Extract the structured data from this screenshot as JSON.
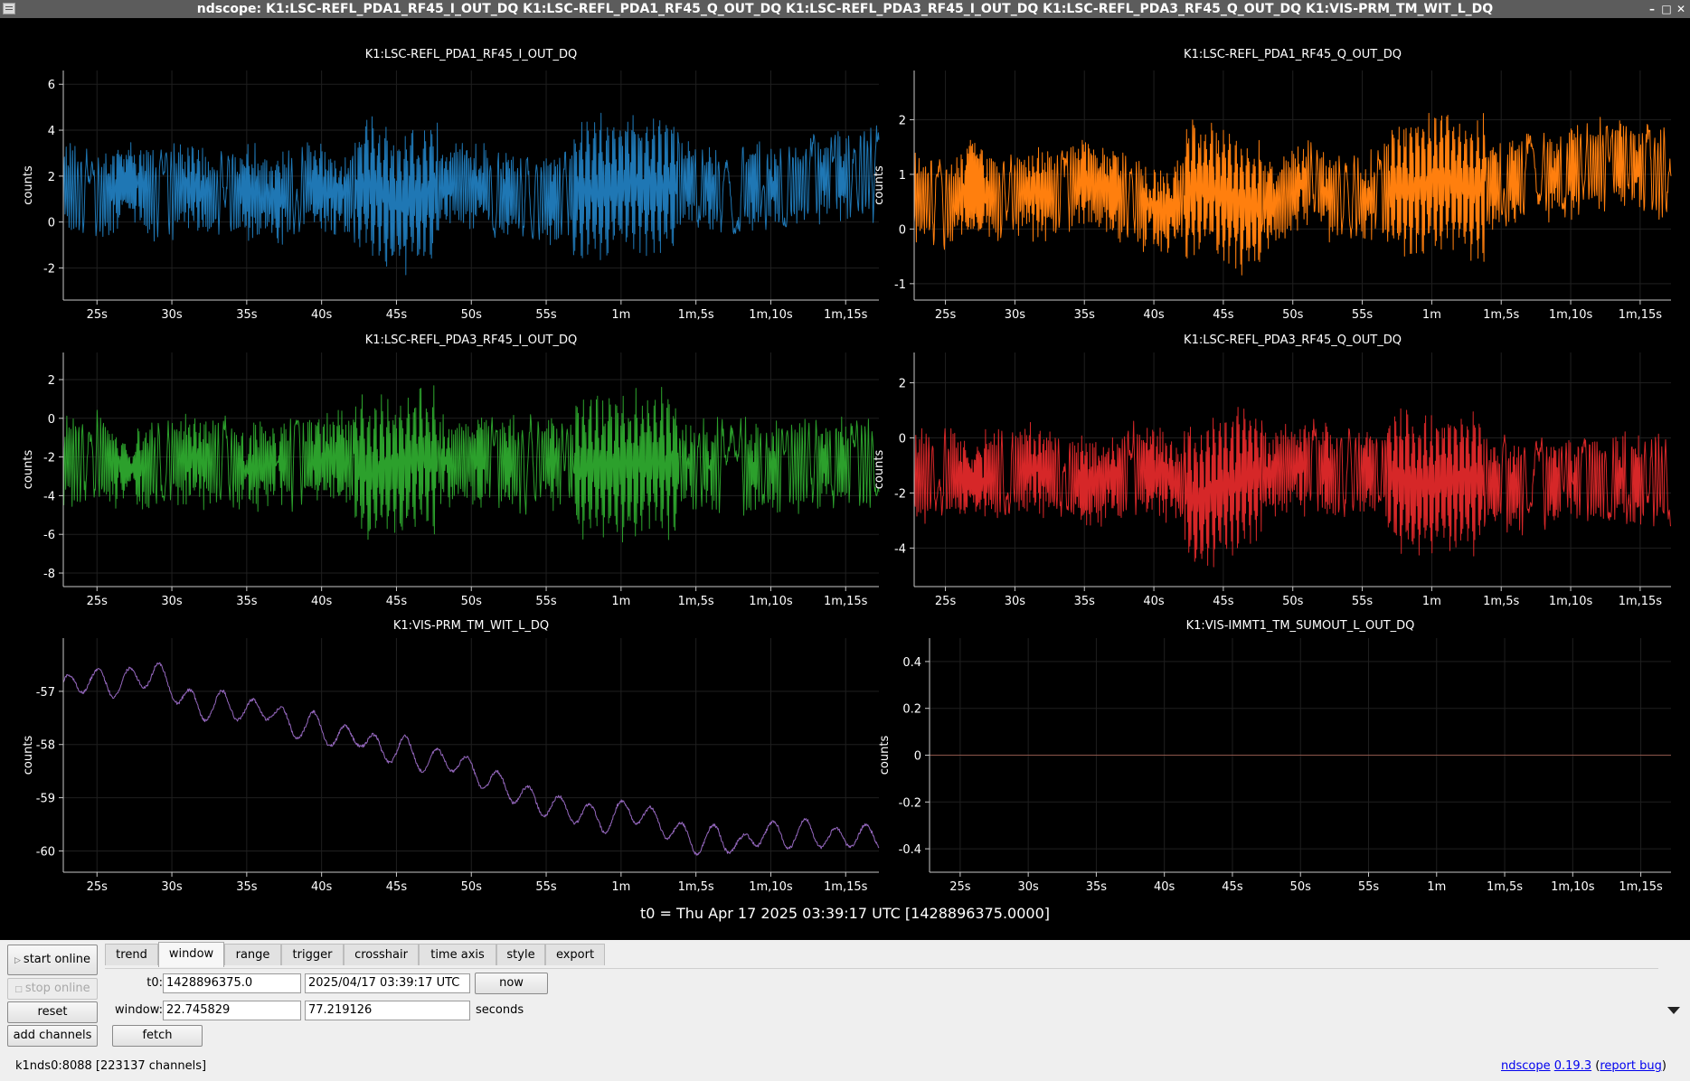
{
  "window": {
    "title": "ndscope: K1:LSC-REFL_PDA1_RF45_I_OUT_DQ K1:LSC-REFL_PDA1_RF45_Q_OUT_DQ K1:LSC-REFL_PDA3_RF45_I_OUT_DQ K1:LSC-REFL_PDA3_RF45_Q_OUT_DQ K1:VIS-PRM_TM_WIT_L_DQ",
    "minimize_glyph": "–",
    "maximize_glyph": "□",
    "close_glyph": "✕"
  },
  "x_ticks": [
    "25s",
    "30s",
    "35s",
    "40s",
    "45s",
    "50s",
    "55s",
    "1m",
    "1m,5s",
    "1m,10s",
    "1m,15s"
  ],
  "x_tick_values": [
    25,
    30,
    35,
    40,
    45,
    50,
    55,
    60,
    65,
    70,
    75
  ],
  "t0_label": "t0 = Thu Apr 17 2025 03:39:17 UTC [1428896375.0000]",
  "chart_data": [
    {
      "type": "line",
      "title": "K1:LSC-REFL_PDA1_RF45_I_OUT_DQ",
      "ylabel": "counts",
      "color": "#1f77b4",
      "xlim": [
        22.75,
        77.22
      ],
      "ylim": [
        -3.4,
        6.6
      ],
      "yticks": [
        -2,
        0,
        2,
        4,
        6
      ],
      "series": [
        {
          "x": [
            22.75,
            25,
            27,
            29,
            31,
            33,
            35,
            37,
            39,
            41,
            43,
            45,
            47,
            49,
            51,
            53,
            55,
            57,
            59,
            61,
            63,
            65,
            67,
            69,
            71,
            73,
            75,
            77.22
          ],
          "y": [
            1.5,
            1.0,
            1.8,
            1.2,
            1.6,
            1.1,
            1.4,
            1.0,
            1.6,
            1.2,
            1.6,
            0.8,
            1.3,
            1.7,
            1.5,
            1.1,
            0.9,
            1.3,
            1.4,
            1.8,
            1.5,
            1.8,
            1.2,
            1.6,
            1.5,
            1.9,
            2.0,
            2.2
          ]
        }
      ]
    },
    {
      "type": "line",
      "title": "K1:LSC-REFL_PDA1_RF45_Q_OUT_DQ",
      "ylabel": "counts",
      "color": "#ff7f0e",
      "xlim": [
        22.75,
        77.22
      ],
      "ylim": [
        -1.3,
        2.9
      ],
      "yticks": [
        -1,
        0,
        1,
        2
      ],
      "series": [
        {
          "x": [
            22.75,
            25,
            27,
            29,
            31,
            33,
            35,
            37,
            39,
            41,
            43,
            45,
            47,
            49,
            51,
            53,
            55,
            57,
            59,
            61,
            63,
            65,
            67,
            69,
            71,
            73,
            75,
            77.22
          ],
          "y": [
            0.6,
            0.4,
            0.8,
            0.5,
            0.7,
            0.6,
            0.9,
            0.7,
            0.5,
            0.3,
            0.8,
            0.6,
            0.4,
            0.5,
            0.9,
            0.6,
            0.5,
            0.7,
            0.8,
            0.9,
            0.7,
            0.8,
            0.9,
            1.0,
            1.1,
            1.2,
            1.1,
            1.0
          ]
        }
      ]
    },
    {
      "type": "line",
      "title": "K1:LSC-REFL_PDA3_RF45_I_OUT_DQ",
      "ylabel": "counts",
      "color": "#2ca02c",
      "xlim": [
        22.75,
        77.22
      ],
      "ylim": [
        -8.7,
        3.4
      ],
      "yticks": [
        -8,
        -6,
        -4,
        -2,
        0,
        2
      ],
      "series": [
        {
          "x": [
            22.75,
            25,
            27,
            29,
            31,
            33,
            35,
            37,
            39,
            41,
            43,
            45,
            47,
            49,
            51,
            53,
            55,
            57,
            59,
            61,
            63,
            65,
            67,
            69,
            71,
            73,
            75,
            77.22
          ],
          "y": [
            -2.2,
            -2.0,
            -2.6,
            -2.4,
            -2.0,
            -2.3,
            -2.6,
            -2.2,
            -2.4,
            -2.0,
            -2.8,
            -2.5,
            -2.1,
            -2.3,
            -2.0,
            -2.4,
            -2.2,
            -2.6,
            -2.5,
            -2.4,
            -2.3,
            -2.4,
            -2.5,
            -2.6,
            -2.4,
            -2.3,
            -2.2,
            -2.4
          ]
        }
      ]
    },
    {
      "type": "line",
      "title": "K1:LSC-REFL_PDA3_RF45_Q_OUT_DQ",
      "ylabel": "counts",
      "color": "#d62728",
      "xlim": [
        22.75,
        77.22
      ],
      "ylim": [
        -5.4,
        3.1
      ],
      "yticks": [
        -4,
        -2,
        0,
        2
      ],
      "series": [
        {
          "x": [
            22.75,
            25,
            27,
            29,
            31,
            33,
            35,
            37,
            39,
            41,
            43,
            45,
            47,
            49,
            51,
            53,
            55,
            57,
            59,
            61,
            63,
            65,
            67,
            69,
            71,
            73,
            75,
            77.22
          ],
          "y": [
            -1.5,
            -1.2,
            -1.6,
            -1.3,
            -1.1,
            -1.4,
            -1.7,
            -1.4,
            -1.2,
            -1.3,
            -2.2,
            -1.8,
            -1.4,
            -1.2,
            -1.0,
            -1.3,
            -1.1,
            -1.4,
            -1.8,
            -1.6,
            -1.5,
            -1.7,
            -1.8,
            -1.6,
            -1.5,
            -1.4,
            -1.6,
            -1.5
          ]
        }
      ]
    },
    {
      "type": "line",
      "title": "K1:VIS-PRM_TM_WIT_L_DQ",
      "ylabel": "counts",
      "color": "#9467bd",
      "xlim": [
        22.75,
        77.22
      ],
      "ylim": [
        -60.4,
        -56.0
      ],
      "yticks": [
        -60,
        -59,
        -58,
        -57
      ],
      "series": [
        {
          "x": [
            22.75,
            24.5,
            26,
            27.5,
            29,
            30.5,
            32,
            33.5,
            35,
            36.5,
            38,
            39.5,
            41,
            42.5,
            44,
            45.5,
            47,
            48.5,
            50,
            51.5,
            53,
            54.5,
            56,
            57.5,
            59,
            60.5,
            62,
            63.5,
            65,
            66.5,
            68,
            69.5,
            71,
            72.5,
            74,
            75.5,
            77.22
          ],
          "y": [
            -56.95,
            -56.75,
            -56.9,
            -56.75,
            -56.65,
            -57.05,
            -57.35,
            -57.2,
            -57.4,
            -57.3,
            -57.7,
            -57.6,
            -57.9,
            -57.8,
            -58.15,
            -58.05,
            -58.35,
            -58.25,
            -58.5,
            -58.7,
            -58.9,
            -59.1,
            -59.2,
            -59.3,
            -59.45,
            -59.2,
            -59.4,
            -59.6,
            -59.85,
            -59.7,
            -59.95,
            -59.6,
            -59.75,
            -59.6,
            -59.8,
            -59.7,
            -59.75
          ]
        }
      ]
    },
    {
      "type": "line",
      "title": "K1:VIS-IMMT1_TM_SUMOUT_L_OUT_DQ",
      "ylabel": "counts",
      "color": "#8c564b",
      "xlim": [
        22.75,
        77.22
      ],
      "ylim": [
        -0.5,
        0.5
      ],
      "yticks": [
        -0.4,
        -0.2,
        0,
        0.2,
        0.4
      ],
      "series": [
        {
          "x": [
            22.75,
            77.22
          ],
          "y": [
            0,
            0
          ]
        }
      ]
    }
  ],
  "controls": {
    "start_online": "start online",
    "stop_online": "stop online",
    "reset": "reset",
    "add_channels": "add channels",
    "tabs": [
      "trend",
      "window",
      "range",
      "trigger",
      "crosshair",
      "time axis",
      "style",
      "export"
    ],
    "active_tab": "window",
    "t0_label": "t0:",
    "t0_gps": "1428896375.0",
    "t0_utc": "2025/04/17 03:39:17 UTC",
    "now": "now",
    "window_label": "window:",
    "window_start": "22.745829",
    "window_end": "77.219126",
    "seconds": "seconds",
    "fetch": "fetch"
  },
  "status": {
    "server": "k1nds0:8088  [223137 channels]",
    "app_name": "ndscope",
    "version": "0.19.3",
    "open_paren": "(",
    "report_bug": "report bug",
    "close_paren": ")"
  }
}
